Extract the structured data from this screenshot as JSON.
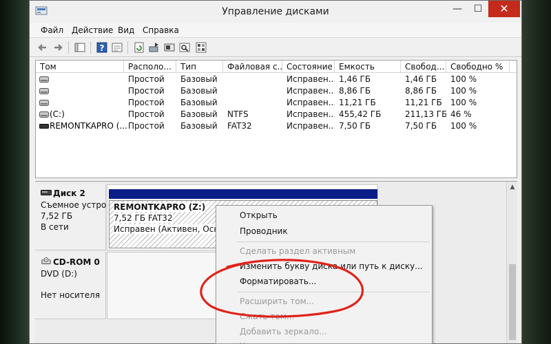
{
  "window": {
    "title": "Управление дисками"
  },
  "menu": [
    "Файл",
    "Действие",
    "Вид",
    "Справка"
  ],
  "volume_table": {
    "columns": [
      "Том",
      "Располо...",
      "Тип",
      "Файловая с...",
      "Состояние",
      "Емкость",
      "Свобод...",
      "Свободно %"
    ],
    "rows": [
      [
        "",
        "Простой",
        "Базовый",
        "",
        "Исправен...",
        "1,46 ГБ",
        "1,46 ГБ",
        "100 %"
      ],
      [
        "",
        "Простой",
        "Базовый",
        "",
        "Исправен...",
        "8,86 ГБ",
        "8,86 ГБ",
        "100 %"
      ],
      [
        "",
        "Простой",
        "Базовый",
        "",
        "Исправен...",
        "11,21 ГБ",
        "11,21 ГБ",
        "100 %"
      ],
      [
        "(C:)",
        "Простой",
        "Базовый",
        "NTFS",
        "Исправен...",
        "455,42 ГБ",
        "211,13 ГБ",
        "46 %"
      ],
      [
        "REMONTKAPRO (...",
        "Простой",
        "Базовый",
        "FAT32",
        "Исправен...",
        "7,50 ГБ",
        "7,50 ГБ",
        "100 %"
      ]
    ]
  },
  "disks": {
    "disk2": {
      "name": "Диск 2",
      "type": "Съемное устро",
      "size": "7,52 ГБ",
      "status": "В сети",
      "partition": {
        "name": "REMONTKAPRO  (Z:)",
        "size_fs": "7,52 ГБ FAT32",
        "status": "Исправен (Активен, Основн"
      }
    },
    "cdrom0": {
      "name": "CD-ROM 0",
      "type": "DVD (D:)",
      "status": "Нет носителя"
    }
  },
  "context_menu": {
    "items": [
      {
        "label": "Открыть",
        "disabled": false
      },
      {
        "label": "Проводник",
        "disabled": false
      },
      {
        "label": "Сделать раздел активным",
        "disabled": true
      },
      {
        "label": "Изменить букву диска или путь к диску...",
        "disabled": false
      },
      {
        "label": "Форматировать...",
        "disabled": false
      },
      {
        "label": "Расширить том...",
        "disabled": true
      },
      {
        "label": "Сжать том...",
        "disabled": true
      },
      {
        "label": "Добавить зеркало...",
        "disabled": true
      },
      {
        "label": "У",
        "disabled": true
      }
    ]
  },
  "colors": {
    "partition_bar": "#0b1d86",
    "annotation_red": "#e0231b",
    "close_button": "#c42b1c"
  }
}
